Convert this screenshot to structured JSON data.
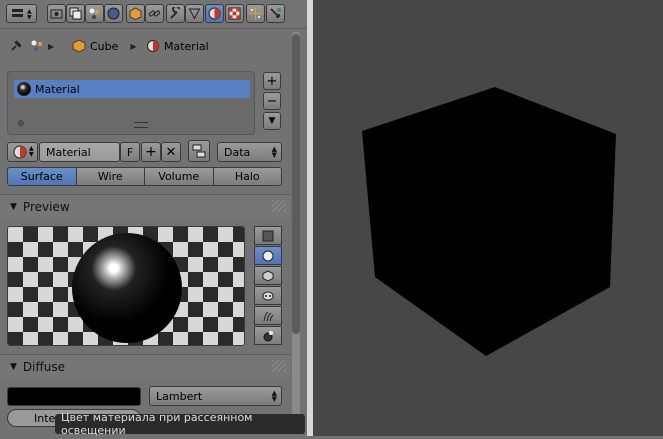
{
  "breadcrumb": {
    "object": "Cube",
    "material": "Material"
  },
  "slot_list": {
    "items": [
      {
        "label": "Material"
      }
    ]
  },
  "id_block": {
    "name": "Material",
    "fake_user": "F",
    "link": "Data"
  },
  "tabs": [
    {
      "label": "Surface",
      "active": true
    },
    {
      "label": "Wire"
    },
    {
      "label": "Volume"
    },
    {
      "label": "Halo"
    }
  ],
  "sections": {
    "preview": "Preview",
    "diffuse": "Diffuse"
  },
  "diffuse": {
    "color": "#000000",
    "shader": "Lambert",
    "intensity_label": "Inten"
  },
  "tooltip": "Цвет материала при рассеянном освещении",
  "icons": [
    "editor-type-icon",
    "render-icon",
    "render-layers-icon",
    "scene-icon",
    "world-icon",
    "object-icon",
    "constraints-icon",
    "modifiers-icon",
    "object-data-icon",
    "material-icon",
    "texture-icon",
    "particles-icon",
    "physics-icon"
  ],
  "colors": {
    "active": "#5680c2",
    "panel": "#727272",
    "viewport": "#474747",
    "cube": "#000000"
  }
}
